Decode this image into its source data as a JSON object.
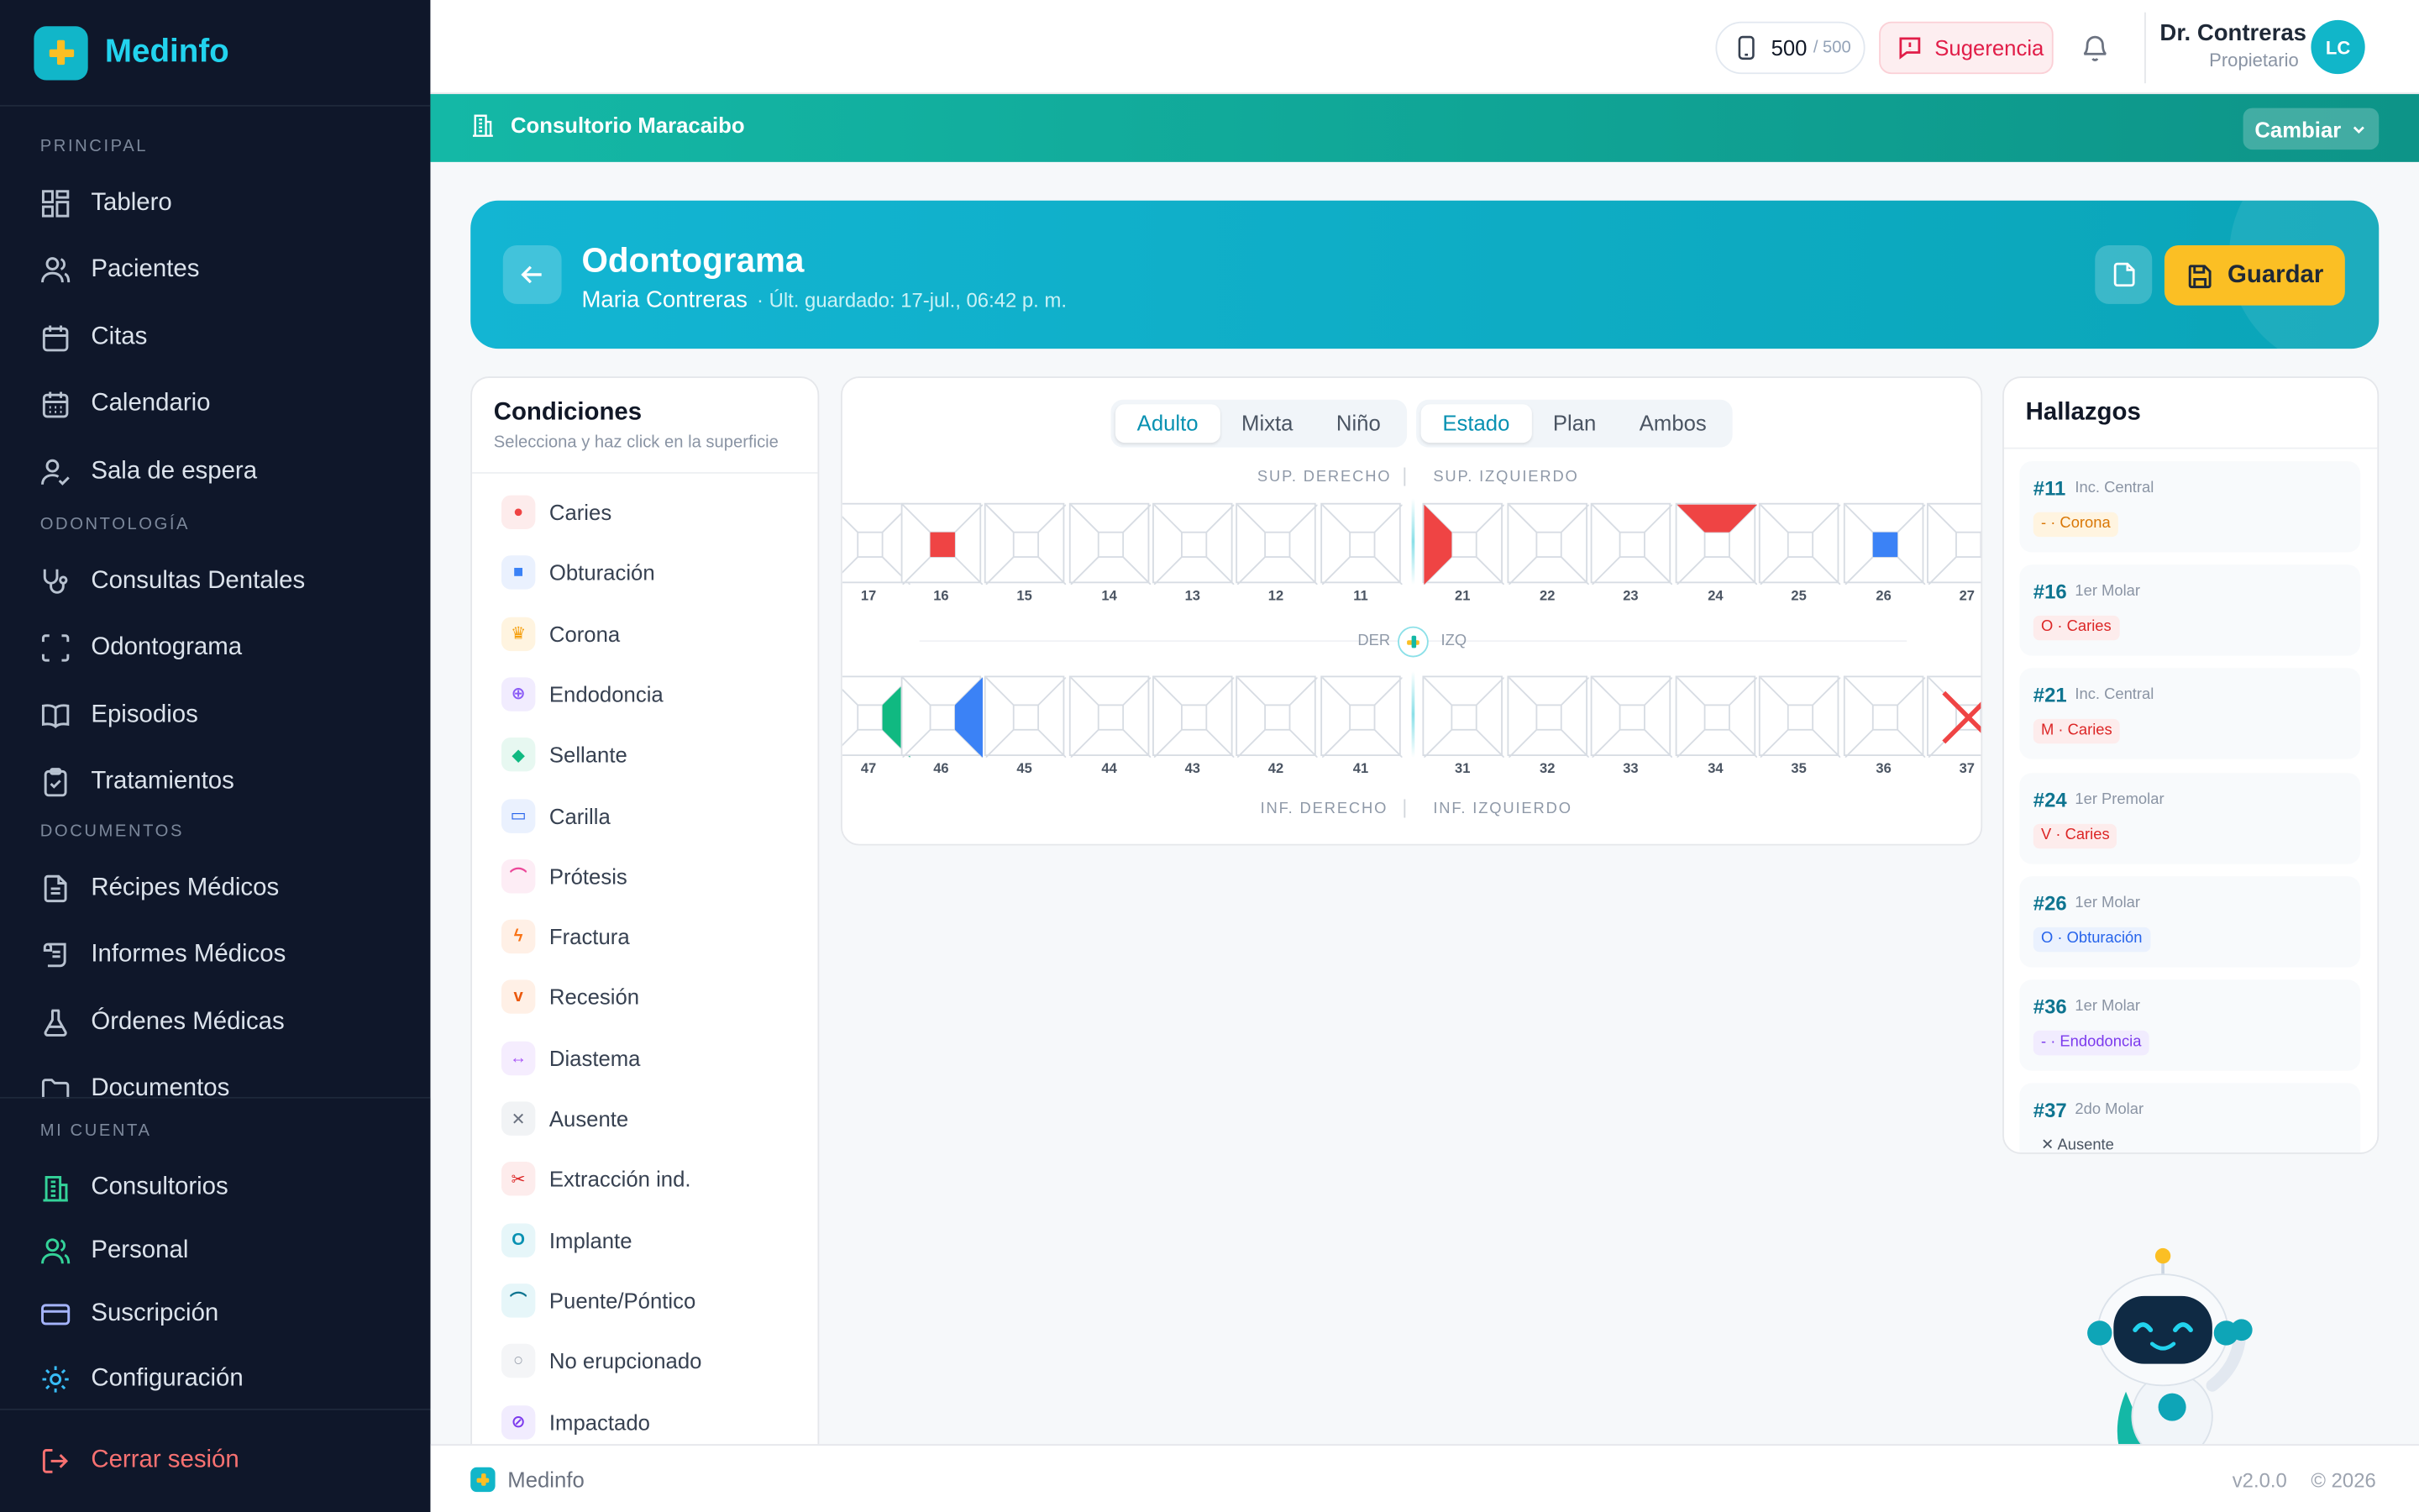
{
  "brand": {
    "name": "Medinfo"
  },
  "sidebar": {
    "sections": {
      "principal": "PRINCIPAL",
      "odontologia": "ODONTOLOGÍA",
      "documentos": "DOCUMENTOS",
      "cuenta": "MI CUENTA"
    },
    "items": [
      "Tablero",
      "Pacientes",
      "Citas",
      "Calendario",
      "Sala de espera",
      "Consultas Dentales",
      "Odontograma",
      "Episodios",
      "Tratamientos",
      "Récipes Médicos",
      "Informes Médicos",
      "Órdenes Médicas",
      "Documentos"
    ],
    "account": [
      "Consultorios",
      "Personal",
      "Suscripción",
      "Configuración"
    ],
    "logout": "Cerrar sesión"
  },
  "topbar": {
    "credits": "500",
    "credits_total": "/ 500",
    "suggestion": "Sugerencia",
    "user_name": "Dr. Contreras",
    "user_role": "Propietario",
    "initials": "LC"
  },
  "office": {
    "name": "Consultorio Maracaibo",
    "change": "Cambiar"
  },
  "header": {
    "title": "Odontograma",
    "patient": "Maria Contreras",
    "saved": "· Últ. guardado: 17-jul., 06:42 p. m.",
    "save": "Guardar"
  },
  "conditions": {
    "title": "Condiciones",
    "subtitle": "Selecciona y haz click en la superficie",
    "items": [
      {
        "label": "Caries",
        "icon": "●",
        "color": "#ef4444",
        "bg": "#fdecec"
      },
      {
        "label": "Obturación",
        "icon": "■",
        "color": "#3b82f6",
        "bg": "#eaf1fe"
      },
      {
        "label": "Corona",
        "icon": "♛",
        "color": "#f59e0b",
        "bg": "#fff4e0"
      },
      {
        "label": "Endodoncia",
        "icon": "⊕",
        "color": "#8b5cf6",
        "bg": "#f1ecfe"
      },
      {
        "label": "Sellante",
        "icon": "◆",
        "color": "#10b981",
        "bg": "#e7f8f1"
      },
      {
        "label": "Carilla",
        "icon": "▭",
        "color": "#2563eb",
        "bg": "#eaf1fe"
      },
      {
        "label": "Prótesis",
        "icon": "⌒",
        "color": "#ec4899",
        "bg": "#fdedf5"
      },
      {
        "label": "Fractura",
        "icon": "ϟ",
        "color": "#f97316",
        "bg": "#fff0e6"
      },
      {
        "label": "Recesión",
        "icon": "v",
        "color": "#ea580c",
        "bg": "#fff0e6"
      },
      {
        "label": "Diastema",
        "icon": "↔",
        "color": "#a855f7",
        "bg": "#f5edfe"
      },
      {
        "label": "Ausente",
        "icon": "✕",
        "color": "#6b7280",
        "bg": "#f1f3f5"
      },
      {
        "label": "Extracción ind.",
        "icon": "✂",
        "color": "#dc2626",
        "bg": "#fdecec"
      },
      {
        "label": "Implante",
        "icon": "O",
        "color": "#0891b2",
        "bg": "#e6f6f9"
      },
      {
        "label": "Puente/Póntico",
        "icon": "⌒",
        "color": "#0e7490",
        "bg": "#e6f6f9"
      },
      {
        "label": "No erupcionado",
        "icon": "○",
        "color": "#9ca3af",
        "bg": "#f4f5f7"
      },
      {
        "label": "Impactado",
        "icon": "⊘",
        "color": "#7c3aed",
        "bg": "#f1ecfe"
      }
    ]
  },
  "odontogram": {
    "dentition": [
      "Adulto",
      "Mixta",
      "Niño"
    ],
    "view": [
      "Estado",
      "Plan",
      "Ambos"
    ],
    "labels": {
      "sup_der": "SUP. DERECHO",
      "sup_izq": "SUP. IZQUIERDO",
      "inf_der": "INF. DERECHO",
      "inf_izq": "INF. IZQUIERDO",
      "der": "DER",
      "izq": "IZQ"
    },
    "upper": [
      "17",
      "16",
      "15",
      "14",
      "13",
      "12",
      "11",
      "21",
      "22",
      "23",
      "24",
      "25",
      "26",
      "27"
    ],
    "lower": [
      "47",
      "46",
      "45",
      "44",
      "43",
      "42",
      "41",
      "31",
      "32",
      "33",
      "34",
      "35",
      "36",
      "37"
    ],
    "marks": [
      {
        "tooth": "16",
        "surface": "O",
        "color": "#ef4444"
      },
      {
        "tooth": "21",
        "surface": "M",
        "color": "#ef4444"
      },
      {
        "tooth": "24",
        "surface": "V",
        "color": "#ef4444"
      },
      {
        "tooth": "26",
        "surface": "O",
        "color": "#3b82f6"
      },
      {
        "tooth": "46",
        "surface": "D",
        "color": "#3b82f6"
      },
      {
        "tooth": "47",
        "surface": "D",
        "color": "#10b981"
      },
      {
        "tooth": "37",
        "surface": "X",
        "color": "#ef4444"
      }
    ]
  },
  "findings": {
    "title": "Hallazgos",
    "items": [
      {
        "num": "#11",
        "name": "Inc. Central",
        "tag": "- · Corona",
        "color": "#d97706",
        "bg": "#fff4e0"
      },
      {
        "num": "#16",
        "name": "1er Molar",
        "tag": "O · Caries",
        "color": "#dc2626",
        "bg": "#fdecec"
      },
      {
        "num": "#21",
        "name": "Inc. Central",
        "tag": "M · Caries",
        "color": "#dc2626",
        "bg": "#fdecec"
      },
      {
        "num": "#24",
        "name": "1er Premolar",
        "tag": "V · Caries",
        "color": "#dc2626",
        "bg": "#fdecec"
      },
      {
        "num": "#26",
        "name": "1er Molar",
        "tag": "O · Obturación",
        "color": "#2563eb",
        "bg": "#eaf1fe"
      },
      {
        "num": "#36",
        "name": "1er Molar",
        "tag": "- · Endodoncia",
        "color": "#7c3aed",
        "bg": "#f1ecfe"
      },
      {
        "num": "#37",
        "name": "2do Molar",
        "tag": "✕ Ausente",
        "color": "#4b5563",
        "bg": "#f8fafc"
      }
    ]
  },
  "footer": {
    "brand": "Medinfo",
    "version": "v2.0.0",
    "copy": "© 2026"
  }
}
